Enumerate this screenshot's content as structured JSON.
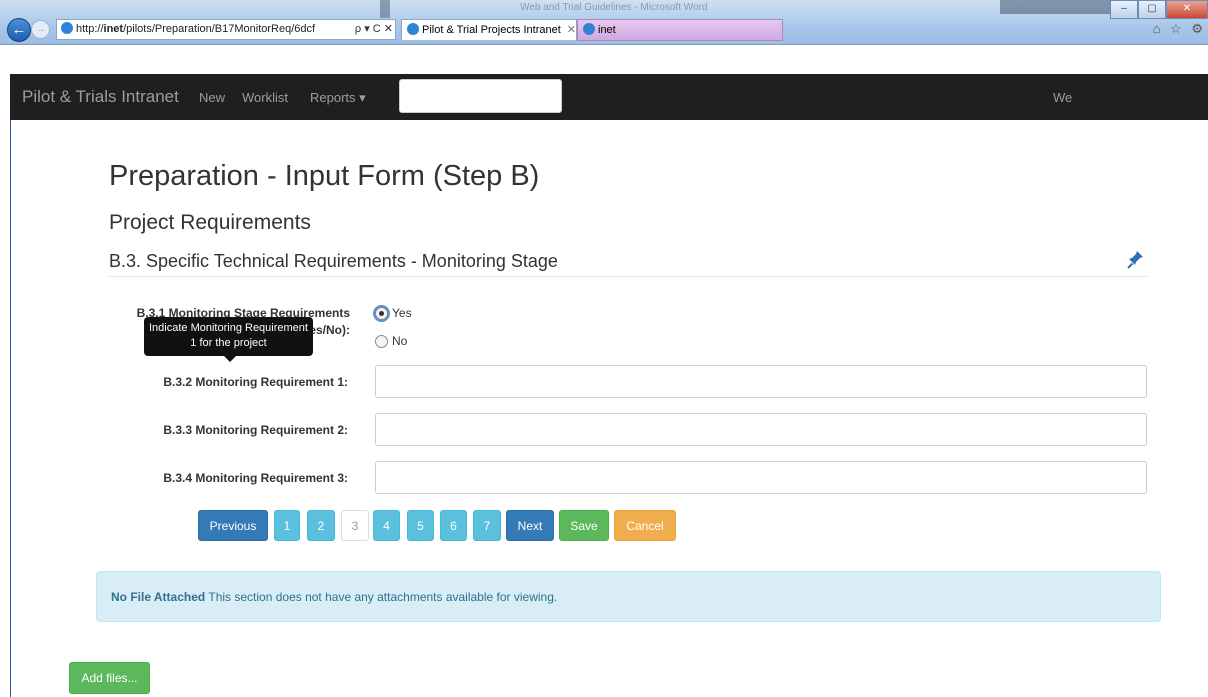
{
  "browser": {
    "window_title": "Web and Trial Guidelines - Microsoft Word",
    "address_prefix": "http://",
    "address_host": "inet",
    "address_path": "/pilots/Preparation/B17MonitorReq/6dcf",
    "address_tools": "ρ ▾ C ✕",
    "tabs": [
      {
        "label": "Pilot & Trial Projects Intranet",
        "close": "✕"
      },
      {
        "label": "inet"
      }
    ],
    "window_buttons": [
      "–",
      "▢",
      "✕"
    ],
    "right_icons": "⌂ ☆ ⚙"
  },
  "navbar": {
    "brand": "Pilot & Trials Intranet",
    "links": [
      "New",
      "Worklist",
      "Reports ▾"
    ],
    "right_text": "We"
  },
  "page": {
    "title": "Preparation - Input Form (Step B)",
    "subtitle": "Project Requirements",
    "section": "B.3. Specific Technical Requirements - Monitoring Stage"
  },
  "form": {
    "q1_label_line1": "B.3.1 Monitoring Stage Requirements",
    "q1_label_line2": "(Yes/No):",
    "options": [
      "Yes",
      "No"
    ],
    "selected": "Yes",
    "tooltip_line1": "Indicate Monitoring Requirement",
    "tooltip_line2": "1 for the project",
    "fields": [
      {
        "label": "B.3.2 Monitoring Requirement 1:",
        "value": ""
      },
      {
        "label": "B.3.3 Monitoring Requirement 2:",
        "value": ""
      },
      {
        "label": "B.3.4 Monitoring Requirement 3:",
        "value": ""
      }
    ]
  },
  "pagination": {
    "previous": "Previous",
    "pages": [
      "1",
      "2",
      "3",
      "4",
      "5",
      "6",
      "7"
    ],
    "current_page": "3",
    "next": "Next",
    "save": "Save",
    "cancel": "Cancel"
  },
  "attachments": {
    "status": "No File Attached",
    "message": "This section does not have any attachments available for viewing.",
    "add_button": "Add files..."
  },
  "colors": {
    "primary": "#337ab7",
    "info": "#5bc0de",
    "success": "#5cb85c",
    "warning": "#f0ad4e",
    "navbar": "#1f1f1f"
  }
}
